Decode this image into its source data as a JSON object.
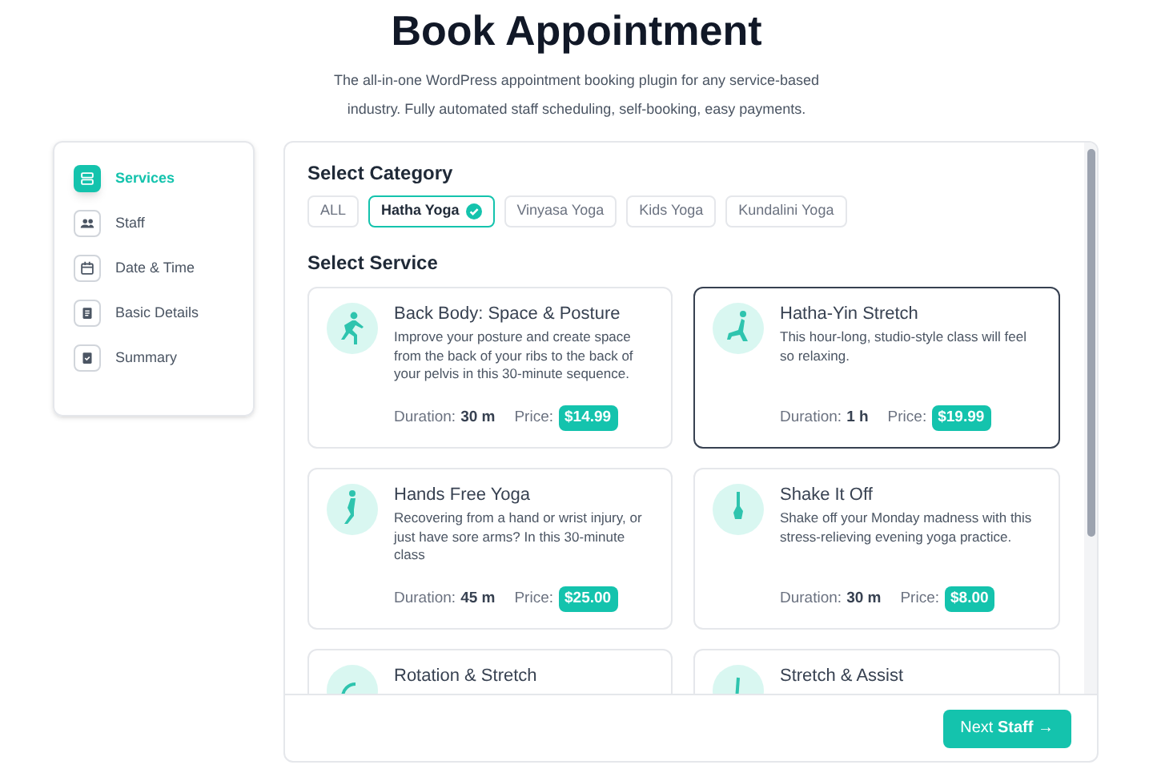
{
  "title": "Book Appointment",
  "subtitle": "The all-in-one WordPress appointment booking plugin for any service-based industry. Fully automated staff scheduling, self-booking, easy payments.",
  "steps": [
    {
      "label": "Services",
      "kind": "services",
      "selected": true
    },
    {
      "label": "Staff",
      "kind": "staff",
      "selected": false
    },
    {
      "label": "Date & Time",
      "kind": "date",
      "selected": false
    },
    {
      "label": "Basic Details",
      "kind": "details",
      "selected": false
    },
    {
      "label": "Summary",
      "kind": "summary",
      "selected": false
    }
  ],
  "category_heading": "Select Category",
  "categories": [
    {
      "label": "ALL",
      "selected": false
    },
    {
      "label": "Hatha Yoga",
      "selected": true
    },
    {
      "label": "Vinyasa Yoga",
      "selected": false
    },
    {
      "label": "Kids Yoga",
      "selected": false
    },
    {
      "label": "Kundalini Yoga",
      "selected": false
    }
  ],
  "service_heading": "Select Service",
  "services": [
    {
      "name": "Back Body: Space & Posture",
      "description": "Improve your posture and create space from the back of your ribs to the back of your pelvis in this 30-minute sequence.",
      "duration_label": "Duration:",
      "duration": "30 m",
      "price_label": "Price:",
      "price": "$14.99",
      "selected": false
    },
    {
      "name": "Hatha-Yin Stretch",
      "description": "This hour-long, studio-style class will feel so relaxing.",
      "duration_label": "Duration:",
      "duration": "1 h",
      "price_label": "Price:",
      "price": "$19.99",
      "selected": true
    },
    {
      "name": "Hands Free Yoga",
      "description": "Recovering from a hand or wrist injury, or just have sore arms? In this 30-minute class",
      "duration_label": "Duration:",
      "duration": "45 m",
      "price_label": "Price:",
      "price": "$25.00",
      "selected": false
    },
    {
      "name": "Shake It Off",
      "description": "Shake off your Monday madness with this stress-relieving evening yoga practice.",
      "duration_label": "Duration:",
      "duration": "30 m",
      "price_label": "Price:",
      "price": "$8.00",
      "selected": false
    },
    {
      "name": "Rotation & Stretch",
      "selected": false
    },
    {
      "name": "Stretch & Assist",
      "selected": false
    }
  ],
  "next_button": "Next **Staff** →"
}
